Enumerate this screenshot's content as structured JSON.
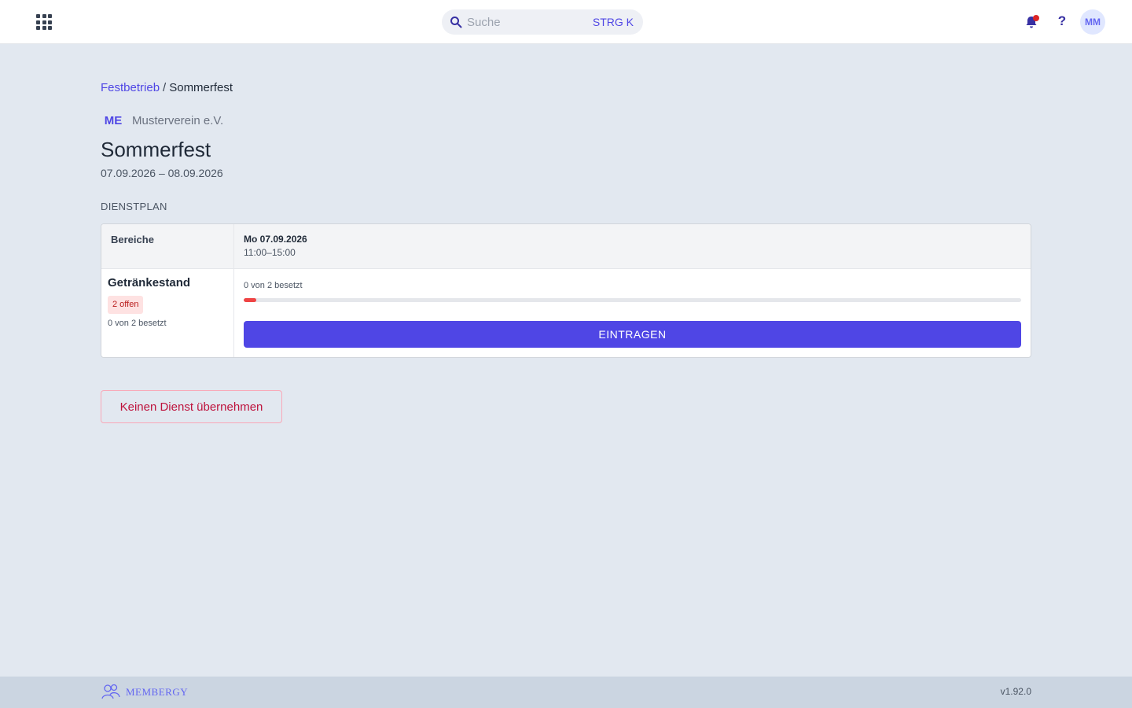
{
  "header": {
    "search_placeholder": "Suche",
    "search_shortcut": "STRG K",
    "avatar_initials": "MM",
    "help_label": "?",
    "has_notification": true
  },
  "breadcrumb": {
    "parent": "Festbetrieb",
    "separator": "/",
    "current": "Sommerfest"
  },
  "organization": {
    "logo_text": "ME",
    "name": "Musterverein e.V."
  },
  "event": {
    "title": "Sommerfest",
    "dates": "07.09.2026 – 08.09.2026"
  },
  "schedule": {
    "section_label": "DIENSTPLAN",
    "areas_header": "Bereiche",
    "columns": [
      {
        "day": "Mo 07.09.2026",
        "time": "11:00–15:00"
      }
    ],
    "areas": [
      {
        "name": "Getränkestand",
        "badge": "2 offen",
        "summary": "0 von 2 besetzt",
        "slots": [
          {
            "status": "0 von 2 besetzt",
            "filled_fraction": 0.0,
            "button_label": "EINTRAGEN"
          }
        ]
      }
    ]
  },
  "actions": {
    "decline_label": "Keinen Dienst übernehmen"
  },
  "footer": {
    "brand": "MEMBERGY",
    "version": "v1.92.0"
  },
  "colors": {
    "accent": "#4f46e5",
    "danger": "#ef4444",
    "background": "#e2e8f0"
  }
}
